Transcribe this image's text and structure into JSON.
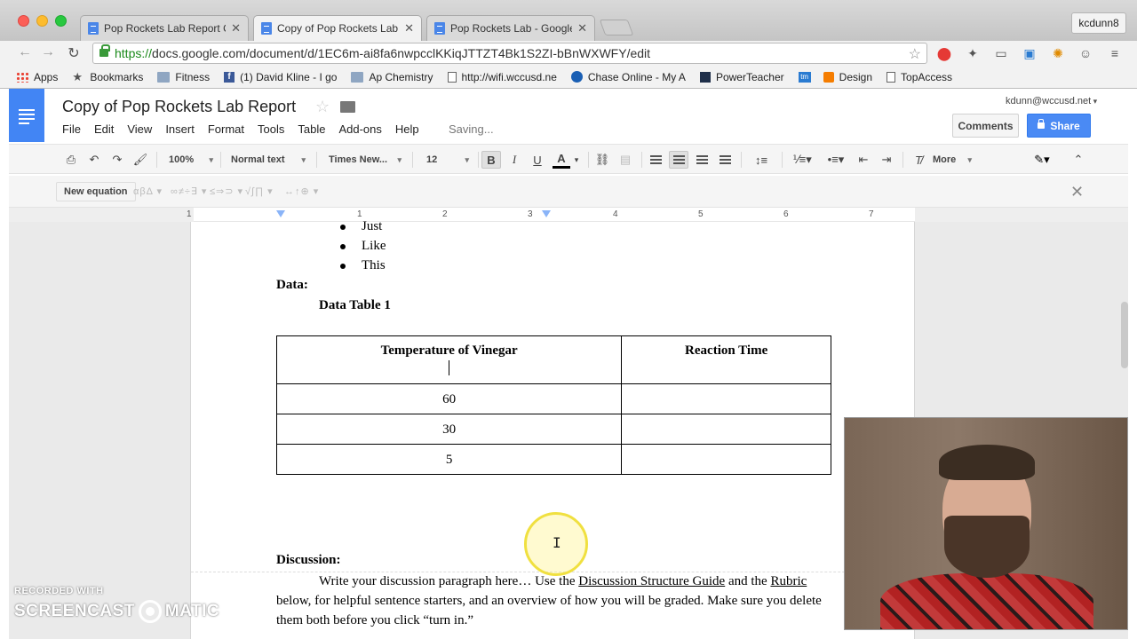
{
  "browser": {
    "tabs": [
      {
        "title": "Pop Rockets Lab Report Ou",
        "active": false
      },
      {
        "title": "Copy of Pop Rockets Lab R",
        "active": true
      },
      {
        "title": "Pop Rockets Lab - Google D",
        "active": false
      }
    ],
    "close_glyph": "✕",
    "profile_name": "kcdunn8",
    "url_scheme": "https://",
    "url_rest": "docs.google.com/document/d/1EC6m-ai8fa6nwpcclKKiqJTTZT4Bk1S2ZI-bBnWXWFY/edit",
    "bookmarks": [
      {
        "label": "Apps",
        "icon": "apps-grid-icon"
      },
      {
        "label": "Bookmarks",
        "icon": "star-icon"
      },
      {
        "label": "Fitness",
        "icon": "folder-icon"
      },
      {
        "label": "(1) David Kline - I go",
        "icon": "facebook-icon"
      },
      {
        "label": "Ap Chemistry",
        "icon": "folder-icon"
      },
      {
        "label": "http://wifi.wccusd.ne",
        "icon": "page-icon"
      },
      {
        "label": "Chase Online - My A",
        "icon": "chase-icon"
      },
      {
        "label": "PowerTeacher",
        "icon": "powerteacher-icon"
      },
      {
        "label": "Design",
        "icon": "blogger-icon"
      },
      {
        "label": "TopAccess",
        "icon": "page-icon"
      }
    ]
  },
  "docs": {
    "title": "Copy of Pop Rockets Lab Report",
    "menu": [
      "File",
      "Edit",
      "View",
      "Insert",
      "Format",
      "Tools",
      "Table",
      "Add-ons",
      "Help"
    ],
    "status": "Saving...",
    "user_email": "kdunn@wccusd.net",
    "comments_label": "Comments",
    "share_label": "Share",
    "toolbar": {
      "zoom": "100%",
      "style": "Normal text",
      "font": "Times New...",
      "size": "12",
      "bold": "B",
      "italic": "I",
      "underline": "U",
      "text_color": "A",
      "more": "More"
    },
    "equation": {
      "new_label": "New equation",
      "symbol_groups": [
        "αβΔ ▾",
        "∞≠÷∃ ▾",
        "≤⇒⊃ ▾",
        "√∫∏ ▾",
        "↔↑⊕ ▾"
      ]
    },
    "ruler_numbers": [
      "1",
      "1",
      "2",
      "3",
      "4",
      "5",
      "6",
      "7"
    ]
  },
  "document": {
    "bullets": [
      "Just",
      "Like",
      "This"
    ],
    "data_heading": "Data:",
    "table_caption": "Data Table 1",
    "table": {
      "headers": [
        "Temperature of Vinegar",
        "Reaction Time"
      ],
      "rows": [
        [
          "60",
          ""
        ],
        [
          "30",
          ""
        ],
        [
          "5",
          ""
        ]
      ]
    },
    "discussion_heading": "Discussion:",
    "discussion": {
      "p1": "Write your discussion paragraph here… Use the ",
      "link1": "Discussion Structure Guide",
      "p2": " and the ",
      "link2": "Rubric",
      "p3": " below, for helpful sentence starters, and an overview of how you will be graded. Make sure you delete them both before you click “turn in.”"
    }
  },
  "overlay": {
    "watermark_top": "RECORDED WITH",
    "watermark_left": "SCREENCAST",
    "watermark_right": "MATIC"
  },
  "colors": {
    "docs_blue": "#4285f4",
    "share_blue": "#4a8af4",
    "https_green": "#1b8a1b"
  }
}
